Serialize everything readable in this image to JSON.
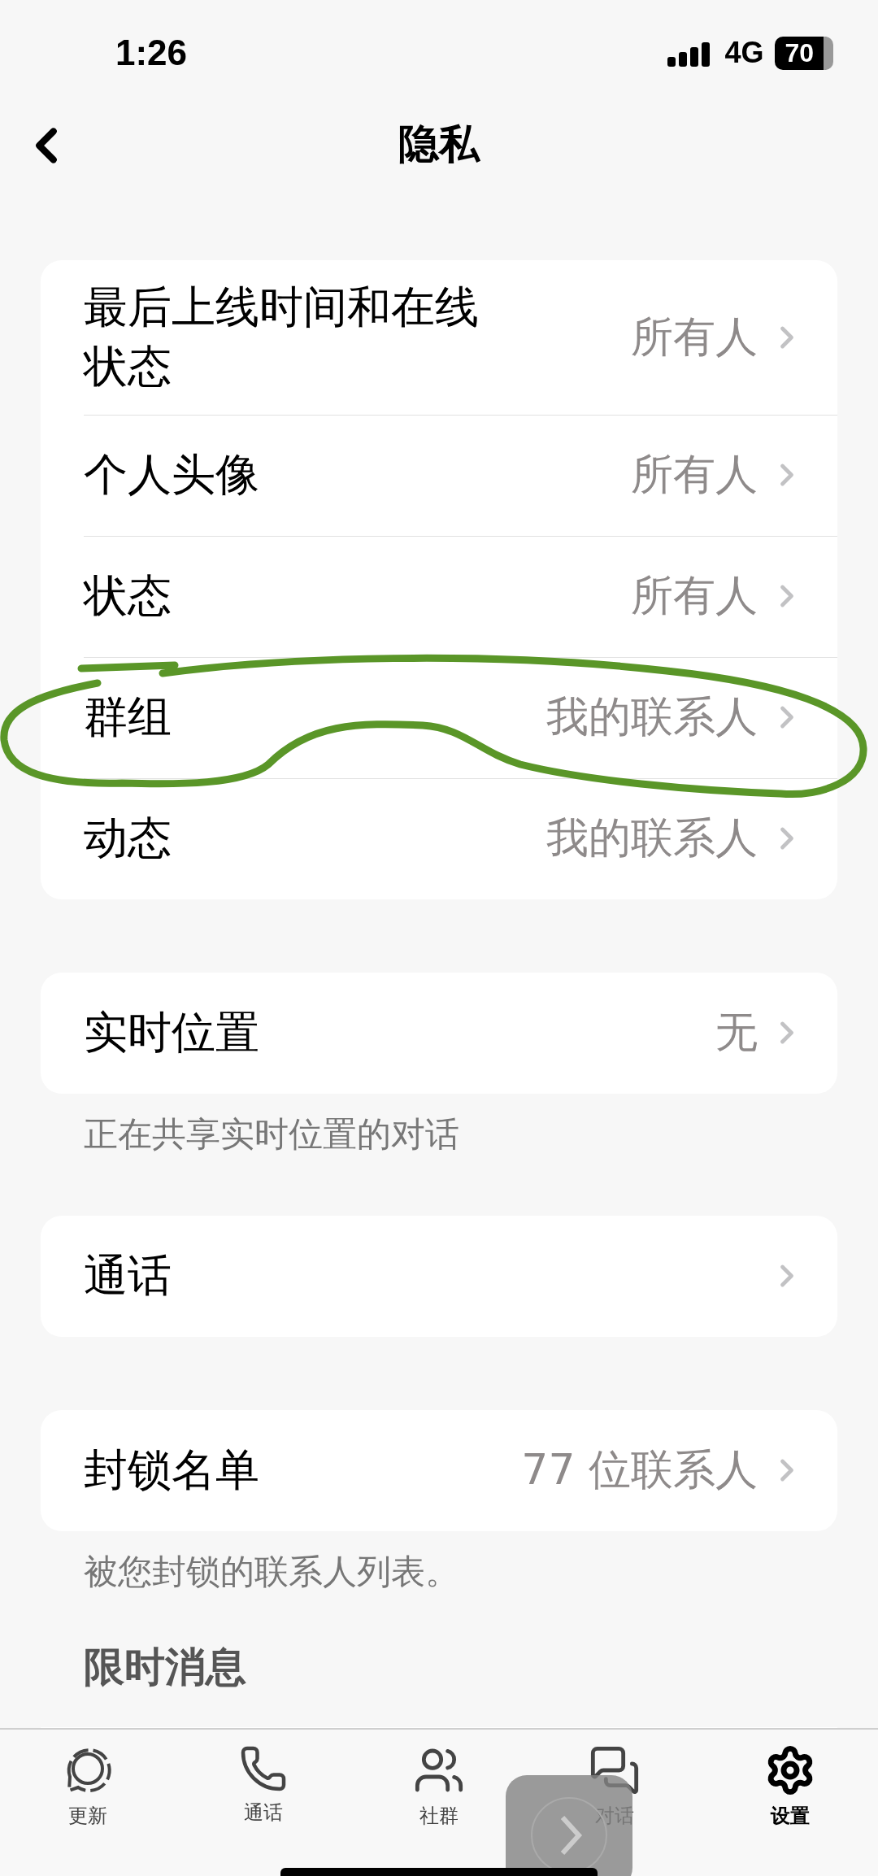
{
  "status_bar": {
    "time": "1:26",
    "network": "4G",
    "battery": "70"
  },
  "nav": {
    "title": "隐私"
  },
  "sections": [
    {
      "rows": [
        {
          "label": "最后上线时间和在线状态",
          "value": "所有人"
        },
        {
          "label": "个人头像",
          "value": "所有人"
        },
        {
          "label": "状态",
          "value": "所有人"
        },
        {
          "label": "群组",
          "value": "我的联系人"
        },
        {
          "label": "动态",
          "value": "我的联系人"
        }
      ]
    },
    {
      "rows": [
        {
          "label": "实时位置",
          "value": "无"
        }
      ],
      "footer": "正在共享实时位置的对话"
    },
    {
      "rows": [
        {
          "label": "通话"
        }
      ]
    },
    {
      "rows": [
        {
          "label": "封锁名单",
          "value": "77 位联系人"
        }
      ],
      "footer": "被您封锁的联系人列表。"
    },
    {
      "header": "限时消息"
    }
  ],
  "tabs": [
    {
      "label": "更新",
      "kind": "updates",
      "selected": false
    },
    {
      "label": "通话",
      "kind": "calls",
      "selected": false
    },
    {
      "label": "社群",
      "kind": "communities",
      "selected": false
    },
    {
      "label": "对话",
      "kind": "chats",
      "selected": false
    },
    {
      "label": "设置",
      "kind": "settings",
      "selected": true
    }
  ]
}
